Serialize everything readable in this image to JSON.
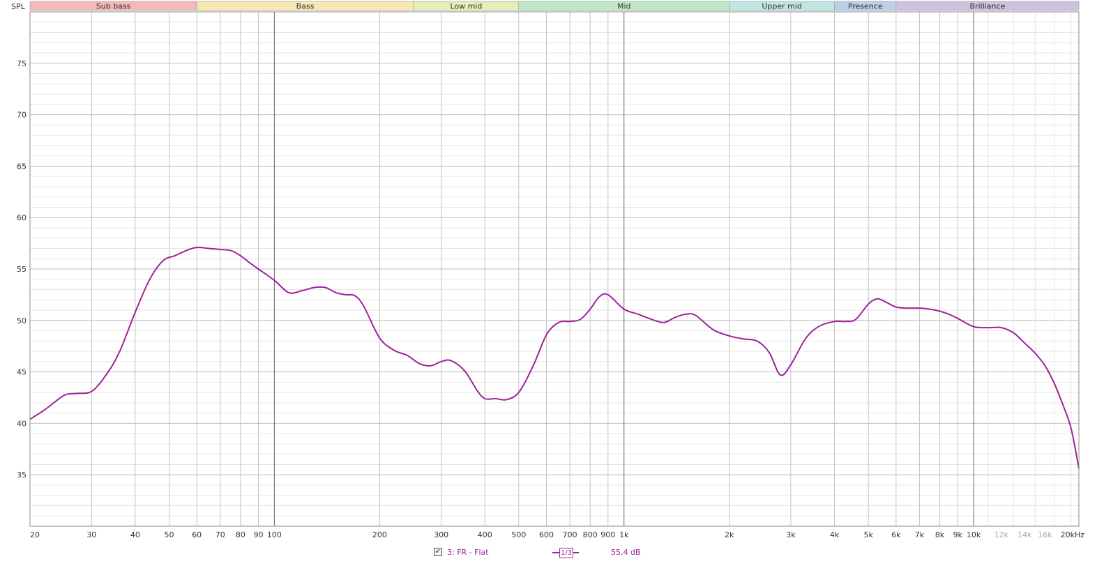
{
  "chart_data": {
    "type": "line",
    "ylabel": "SPL",
    "xlabel": "",
    "x_scale": "log",
    "xlim": [
      20,
      20000
    ],
    "ylim": [
      30,
      80
    ],
    "y_ticks": [
      35,
      40,
      45,
      50,
      55,
      60,
      65,
      70,
      75
    ],
    "x_ticks": [
      {
        "value": 20,
        "label": "20"
      },
      {
        "value": 30,
        "label": "30"
      },
      {
        "value": 40,
        "label": "40"
      },
      {
        "value": 50,
        "label": "50"
      },
      {
        "value": 60,
        "label": "60"
      },
      {
        "value": 70,
        "label": "70"
      },
      {
        "value": 80,
        "label": "80"
      },
      {
        "value": 90,
        "label": "90"
      },
      {
        "value": 100,
        "label": "100"
      },
      {
        "value": 200,
        "label": "200"
      },
      {
        "value": 300,
        "label": "300"
      },
      {
        "value": 400,
        "label": "400"
      },
      {
        "value": 500,
        "label": "500"
      },
      {
        "value": 600,
        "label": "600"
      },
      {
        "value": 700,
        "label": "700"
      },
      {
        "value": 800,
        "label": "800"
      },
      {
        "value": 900,
        "label": "900"
      },
      {
        "value": 1000,
        "label": "1k"
      },
      {
        "value": 2000,
        "label": "2k"
      },
      {
        "value": 3000,
        "label": "3k"
      },
      {
        "value": 4000,
        "label": "4k"
      },
      {
        "value": 5000,
        "label": "5k"
      },
      {
        "value": 6000,
        "label": "6k"
      },
      {
        "value": 7000,
        "label": "7k"
      },
      {
        "value": 8000,
        "label": "8k"
      },
      {
        "value": 9000,
        "label": "9k"
      },
      {
        "value": 10000,
        "label": "10k"
      },
      {
        "value": 12000,
        "label": "12k",
        "faded": true
      },
      {
        "value": 14000,
        "label": "14k",
        "faded": true
      },
      {
        "value": 16000,
        "label": "16k",
        "faded": true
      },
      {
        "value": 20000,
        "label": "20kHz"
      }
    ],
    "bands": [
      {
        "label": "Sub bass",
        "from": 20,
        "to": 60,
        "color": "#f4b8bb"
      },
      {
        "label": "Bass",
        "from": 60,
        "to": 250,
        "color": "#f8e8b4"
      },
      {
        "label": "Low mid",
        "from": 250,
        "to": 500,
        "color": "#e2f0b8"
      },
      {
        "label": "Mid",
        "from": 500,
        "to": 2000,
        "color": "#bfe8c6"
      },
      {
        "label": "Upper mid",
        "from": 2000,
        "to": 4000,
        "color": "#bfe6e2"
      },
      {
        "label": "Presence",
        "from": 4000,
        "to": 6000,
        "color": "#bccfe8"
      },
      {
        "label": "Brilliance",
        "from": 6000,
        "to": 20000,
        "color": "#cfc0de"
      }
    ],
    "series": [
      {
        "name": "3: FR - Flat",
        "color": "#a0219a",
        "x": [
          20,
          22,
          25,
          27,
          30,
          33,
          36,
          40,
          44,
          48,
          52,
          56,
          60,
          65,
          70,
          75,
          80,
          85,
          90,
          100,
          110,
          120,
          130,
          140,
          150,
          160,
          170,
          180,
          200,
          220,
          240,
          260,
          280,
          300,
          320,
          350,
          380,
          400,
          430,
          460,
          500,
          550,
          600,
          650,
          700,
          750,
          800,
          850,
          900,
          1000,
          1100,
          1200,
          1300,
          1400,
          1500,
          1600,
          1800,
          2000,
          2200,
          2400,
          2600,
          2800,
          3000,
          3300,
          3600,
          4000,
          4300,
          4600,
          5000,
          5300,
          5600,
          6000,
          6500,
          7000,
          7500,
          8000,
          8500,
          9000,
          10000,
          11000,
          12000,
          13000,
          14000,
          15000,
          16000,
          17000,
          18000,
          19000,
          20000
        ],
        "values": [
          40.4,
          41.3,
          42.7,
          42.9,
          43.1,
          44.7,
          46.9,
          50.8,
          54.0,
          55.8,
          56.3,
          56.8,
          57.1,
          57.0,
          56.9,
          56.8,
          56.3,
          55.6,
          55.0,
          53.9,
          52.7,
          52.9,
          53.2,
          53.2,
          52.7,
          52.5,
          52.4,
          51.4,
          48.3,
          47.1,
          46.6,
          45.8,
          45.6,
          46.0,
          46.1,
          45.1,
          43.2,
          42.4,
          42.4,
          42.3,
          43.0,
          45.6,
          48.6,
          49.8,
          49.9,
          50.1,
          51.1,
          52.3,
          52.5,
          51.1,
          50.6,
          50.1,
          49.8,
          50.3,
          50.6,
          50.5,
          49.1,
          48.5,
          48.2,
          48.0,
          46.9,
          44.7,
          45.7,
          48.2,
          49.4,
          49.9,
          49.9,
          50.1,
          51.6,
          52.1,
          51.8,
          51.3,
          51.2,
          51.2,
          51.1,
          50.9,
          50.6,
          50.2,
          49.4,
          49.3,
          49.3,
          48.8,
          47.8,
          46.8,
          45.6,
          43.9,
          41.8,
          39.5,
          35.6
        ]
      }
    ],
    "grid": true,
    "legend": "bottom-center"
  },
  "legend": {
    "checked": true,
    "check_glyph": "✓",
    "series_name": "3: FR - Flat",
    "smoothing": "1/3",
    "value": "55,4 dB"
  }
}
